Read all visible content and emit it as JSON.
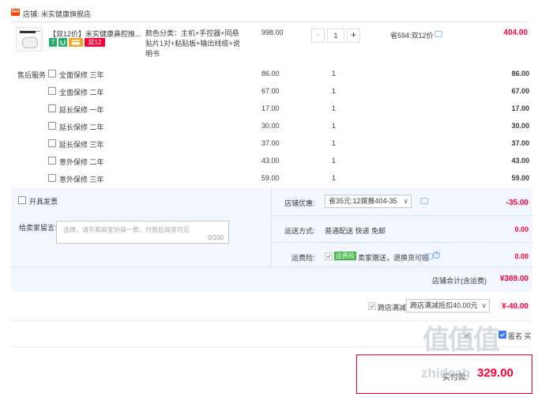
{
  "shop": {
    "label": "店铺:",
    "name": "米实健康旗舰店",
    "icon_text": "tao"
  },
  "item": {
    "title": "【双12价】米实健康鼻腔推...",
    "badges": [
      "7",
      "",
      "",
      "双12"
    ],
    "badge_colors": [
      "#26a96b",
      "#26a96b",
      "#f5a623",
      "#ff0036"
    ],
    "spec": "颜色分类：主机+手控器+同悬贴片1对+粘贴板+输出线缆+说明书",
    "unit_price": "998.00",
    "quantity": "1",
    "minus": "−",
    "plus": "+",
    "promo": "省594:双12价",
    "total": "404.00"
  },
  "services": {
    "label": "售后服务",
    "rows": [
      {
        "name": "全面保修 三年",
        "price": "86.00",
        "qty": "1",
        "total": "86.00"
      },
      {
        "name": "全面保修 二年",
        "price": "67.00",
        "qty": "1",
        "total": "67.00"
      },
      {
        "name": "延长保修 一年",
        "price": "17.00",
        "qty": "1",
        "total": "17.00"
      },
      {
        "name": "延长保修 二年",
        "price": "30.00",
        "qty": "1",
        "total": "30.00"
      },
      {
        "name": "延长保修 三年",
        "price": "37.00",
        "qty": "1",
        "total": "37.00"
      },
      {
        "name": "意外保修 二年",
        "price": "43.00",
        "qty": "1",
        "total": "43.00"
      },
      {
        "name": "意外保修 三年",
        "price": "59.00",
        "qty": "1",
        "total": "59.00"
      }
    ]
  },
  "invoice": {
    "label": "开具发票"
  },
  "shop_discount": {
    "label": "店铺优惠:",
    "selected": "省35元:12拨推404-35",
    "amount": "-35.00"
  },
  "message": {
    "label": "给卖家留言:",
    "placeholder": "选填，请先和商家协商一致，付款后商家可见",
    "counter": "0/200"
  },
  "shipping": {
    "label": "运送方式:",
    "value": "普通配送 快递 免邮",
    "amount": "0.00"
  },
  "insurance": {
    "label": "运费险:",
    "tag": "运费险",
    "value": "卖家赠送，退换货可赔",
    "amount": "0.00"
  },
  "shop_total": {
    "label": "店铺合计(含运费)",
    "amount": "¥369.00"
  },
  "store_promo": {
    "label": "跨店满减",
    "selected": "跨店满减抵扣40.00元",
    "amount": "¥-40.00"
  },
  "partial_text": {
    "left": "式",
    "right": "匿名 买"
  },
  "final": {
    "label": "实付款:",
    "amount": "329.00"
  },
  "watermark": {
    "top": "值值值",
    "bottom": "zhidezh"
  }
}
